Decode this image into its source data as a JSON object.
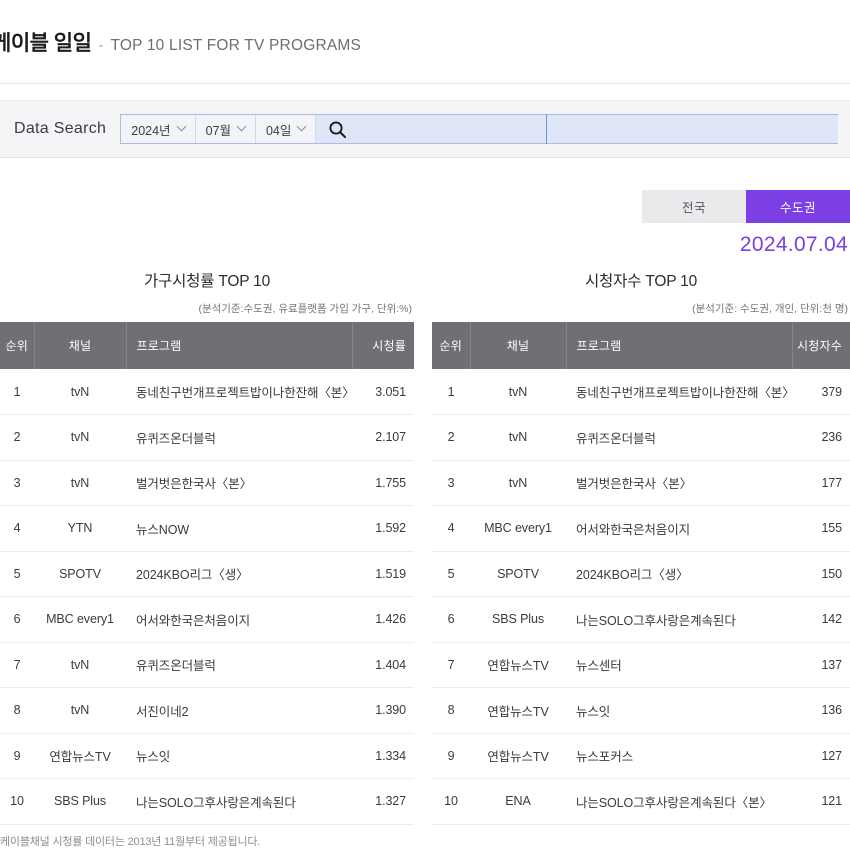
{
  "header": {
    "title_ko": "케이블 일일",
    "dash": "-",
    "title_en": "TOP 10 LIST FOR TV PROGRAMS"
  },
  "search": {
    "label": "Data Search",
    "year": "2024년",
    "month": "07월",
    "day": "04일",
    "search_icon": "search-icon",
    "keyword_value": "",
    "keyword_placeholder": ""
  },
  "region": {
    "nationwide": "전국",
    "metro": "수도권",
    "active": "수도권",
    "active_color": "#7B3FE4",
    "date": "2024.07.04"
  },
  "left_table": {
    "title": "가구시청률 TOP 10",
    "subtitle": "(분석기준:수도권, 유료플랫폼 가입 가구, 단위:%)",
    "columns": [
      "순위",
      "채널",
      "프로그램",
      "시청률"
    ],
    "rows": [
      {
        "rank": "1",
        "channel": "tvN",
        "program": "동네친구번개프로젝트밥이나한잔해〈본〉",
        "value": "3.051"
      },
      {
        "rank": "2",
        "channel": "tvN",
        "program": "유퀴즈온더블럭",
        "value": "2.107"
      },
      {
        "rank": "3",
        "channel": "tvN",
        "program": "벌거벗은한국사〈본〉",
        "value": "1.755"
      },
      {
        "rank": "4",
        "channel": "YTN",
        "program": "뉴스NOW",
        "value": "1.592"
      },
      {
        "rank": "5",
        "channel": "SPOTV",
        "program": "2024KBO리그〈생〉",
        "value": "1.519"
      },
      {
        "rank": "6",
        "channel": "MBC every1",
        "program": "어서와한국은처음이지",
        "value": "1.426"
      },
      {
        "rank": "7",
        "channel": "tvN",
        "program": "유퀴즈온더블럭",
        "value": "1.404"
      },
      {
        "rank": "8",
        "channel": "tvN",
        "program": "서진이네2",
        "value": "1.390"
      },
      {
        "rank": "9",
        "channel": "연합뉴스TV",
        "program": "뉴스잇",
        "value": "1.334"
      },
      {
        "rank": "10",
        "channel": "SBS Plus",
        "program": "나는SOLO그후사랑은계속된다",
        "value": "1.327"
      }
    ]
  },
  "right_table": {
    "title": "시청자수 TOP 10",
    "subtitle": "(분석기준: 수도권, 개인, 단위:천 명)",
    "columns": [
      "순위",
      "채널",
      "프로그램",
      "시청자수"
    ],
    "rows": [
      {
        "rank": "1",
        "channel": "tvN",
        "program": "동네친구번개프로젝트밥이나한잔해〈본〉",
        "value": "379"
      },
      {
        "rank": "2",
        "channel": "tvN",
        "program": "유퀴즈온더블럭",
        "value": "236"
      },
      {
        "rank": "3",
        "channel": "tvN",
        "program": "벌거벗은한국사〈본〉",
        "value": "177"
      },
      {
        "rank": "4",
        "channel": "MBC every1",
        "program": "어서와한국은처음이지",
        "value": "155"
      },
      {
        "rank": "5",
        "channel": "SPOTV",
        "program": "2024KBO리그〈생〉",
        "value": "150"
      },
      {
        "rank": "6",
        "channel": "SBS Plus",
        "program": "나는SOLO그후사랑은계속된다",
        "value": "142"
      },
      {
        "rank": "7",
        "channel": "연합뉴스TV",
        "program": "뉴스센터",
        "value": "137"
      },
      {
        "rank": "8",
        "channel": "연합뉴스TV",
        "program": "뉴스잇",
        "value": "136"
      },
      {
        "rank": "9",
        "channel": "연합뉴스TV",
        "program": "뉴스포커스",
        "value": "127"
      },
      {
        "rank": "10",
        "channel": "ENA",
        "program": "나는SOLO그후사랑은계속된다〈본〉",
        "value": "121"
      }
    ]
  },
  "footer": {
    "note": "케이블채널 시청률 데이터는 2013년 11월부터 제공됩니다."
  }
}
